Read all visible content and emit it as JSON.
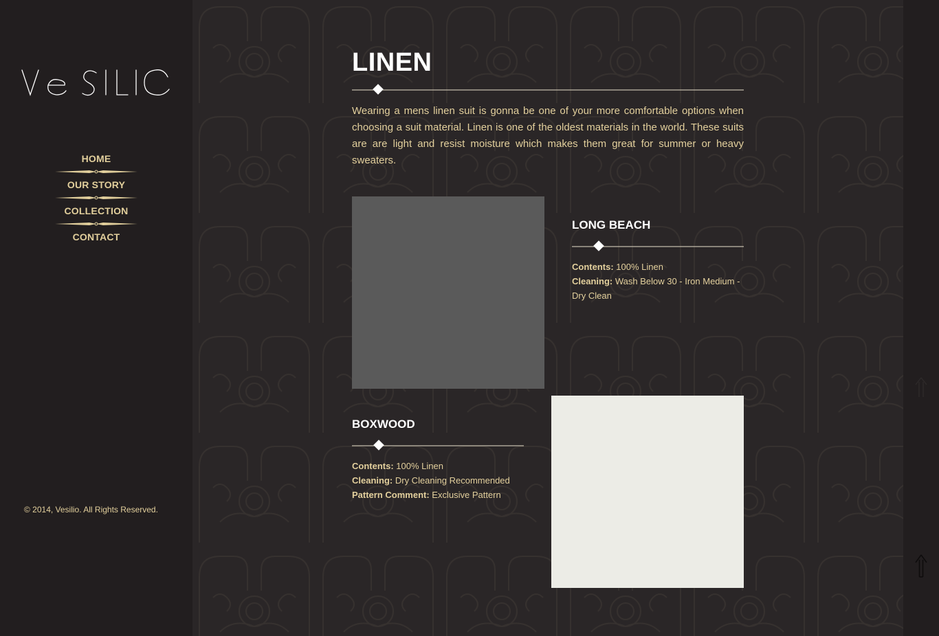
{
  "brand": {
    "logo_text": "Vesilio"
  },
  "nav": {
    "items": [
      {
        "label": "HOME"
      },
      {
        "label": "OUR STORY"
      },
      {
        "label": "COLLECTION"
      },
      {
        "label": "CONTACT"
      }
    ]
  },
  "footer": {
    "copyright": "© 2014, Vesilio. All Rights Reserved."
  },
  "main": {
    "title": "LINEN",
    "intro": "Wearing a mens linen suit is gonna be one of your more comfortable options when choosing a suit material. Linen is one of the oldest materials in the world. These suits are are light and resist moisture which makes them great for summer or heavy sweaters.",
    "products": [
      {
        "name": "LONG BEACH",
        "swatch_color": "#5a5a5a",
        "specs": [
          {
            "label": "Contents:",
            "value": " 100% Linen"
          },
          {
            "label": "Cleaning:",
            "value": " Wash Below 30 - Iron Medium - Dry Clean"
          }
        ]
      },
      {
        "name": "BOXWOOD",
        "swatch_color": "#ecece6",
        "specs": [
          {
            "label": "Contents:",
            "value": " 100% Linen"
          },
          {
            "label": "Cleaning:",
            "value": " Dry Cleaning Recommended"
          },
          {
            "label": "Pattern Comment:",
            "value": " Exclusive Pattern"
          }
        ]
      }
    ]
  },
  "colors": {
    "accent": "#e2cf9c",
    "background": "#231f20",
    "main_background": "#2a2627",
    "heading": "#ffffff"
  },
  "icons": {
    "scroll_top": "arrow-up-icon"
  }
}
